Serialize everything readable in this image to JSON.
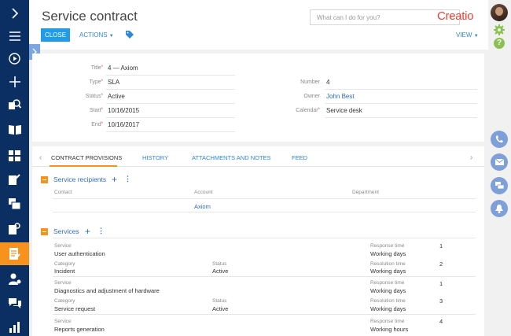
{
  "header": {
    "title": "Service contract",
    "search_placeholder": "What can I do for you?",
    "logo": "Creatio",
    "close_label": "CLOSE",
    "actions_label": "ACTIONS",
    "view_label": "VIEW"
  },
  "form": {
    "title": {
      "label": "Title",
      "value": "4 — Axiom"
    },
    "type": {
      "label": "Type",
      "value": "SLA"
    },
    "status": {
      "label": "Status",
      "value": "Active"
    },
    "start": {
      "label": "Start",
      "value": "10/16/2015"
    },
    "end": {
      "label": "End",
      "value": "10/16/2017"
    },
    "number": {
      "label": "Number",
      "value": "4"
    },
    "owner": {
      "label": "Owner",
      "value": "John Best"
    },
    "calendar": {
      "label": "Calendar",
      "value": "Service desk"
    }
  },
  "tabs": [
    "CONTRACT PROVISIONS",
    "HISTORY",
    "ATTACHMENTS AND NOTES",
    "FEED"
  ],
  "recipients": {
    "title": "Service recipients",
    "columns": [
      "Contact",
      "Account",
      "Department"
    ],
    "row": {
      "contact": "",
      "account": "Axiom",
      "department": ""
    }
  },
  "services": {
    "title": "Services",
    "labels": {
      "service": "Service",
      "category": "Category",
      "status": "Status",
      "response_time": "Response time",
      "resolution_time": "Resolution time"
    },
    "items": [
      {
        "service": "User authentication",
        "category": "Incident",
        "status": "Active",
        "response_value": "1",
        "response_unit": "Working days",
        "resolution_value": "2",
        "resolution_unit": "Working days"
      },
      {
        "service": "Diagnostics and adjustment of hardware",
        "category": "Service request",
        "status": "Active",
        "response_value": "1",
        "response_unit": "Working days",
        "resolution_value": "3",
        "resolution_unit": "Working days"
      },
      {
        "service": "Reports generation",
        "response_value": "4",
        "response_unit": "Working hours"
      }
    ]
  },
  "colors": {
    "sidebar": "#0c2f63",
    "accent": "#f7931d",
    "primary": "#1f9be8",
    "link": "#2d6bc4"
  }
}
